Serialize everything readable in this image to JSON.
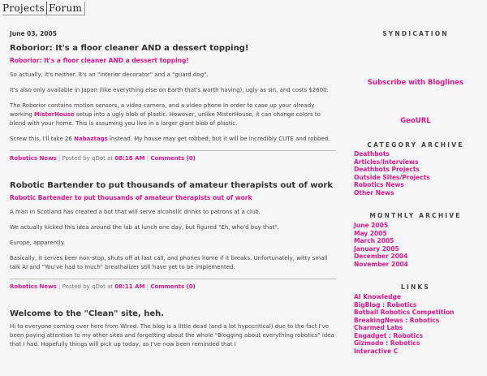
{
  "header": {
    "logo_left": "Projects",
    "logo_right": "Forum"
  },
  "posts": [
    {
      "date": "June 03, 2005",
      "title": "Roborior: It's a floor cleaner AND a dessert topping!",
      "link": "Roborior: It's a floor cleaner AND a dessert topping!",
      "p1": "So actually, it's neither. It's an \"interior decorator\" and a \"guard dog\".",
      "p2": "It's also only available in Japan (like everything else on Earth that's worth having), ugly as sin, and costs $2600.",
      "p3a": "The Roborior contains motion sensors, a video camera, and a video phone in order to case up your already working ",
      "p3link": "MisterHouse",
      "p3b": " setup into a ugly blob of plastic. However, unlike MisterHouse, it can change colors to blend with your home. This is assuming you live in a larger giant blob of plastic.",
      "p4a": "Screw this, I'll take 26 ",
      "p4link": "Nabaztags",
      "p4b": " instead. My house may get robbed, but it will be incredibly CUTE and robbed.",
      "category": "Robotics News",
      "posted": "Posted by qDot at",
      "time": "08:18 AM",
      "comments": "Comments (0)"
    },
    {
      "title": "Robotic Bartender to put thousands of amateur therapists out of work",
      "link": "Robotic Bartender to put thousands of amateur therapists out of work",
      "p1": "A man in Scotland has created a bot that will serve alcoholic drinks to patrons at a club.",
      "p2": "We actually kicked this idea around the lab at lunch one day, but figured \"Eh, who'd buy that\".",
      "p3": "Europe, apparently.",
      "p4": "Basically, it serves beer non-stop, shuts off at last call, and phones home if it breaks. Unfortunately, witty small talk AI and \"You've had to much\" breathalizer still have yet to be implemented.",
      "category": "Robotics News",
      "posted": "Posted by qDot at",
      "time": "08:11 AM",
      "comments": "Comments (0)"
    },
    {
      "title": "Welcome to the \"Clean\" site, heh.",
      "p1": "Hi to everyone coming over here from Wired. The blog is a little dead (and a lot hypocritical) due to the fact I've been paying attention to my other sites and forgetting about the whole \"Blogging about everything robotics\" idea that I had. Hopefully things will pick up today, as I've now been reminded that I"
    }
  ],
  "sidebar": {
    "syndication": "SYNDICATION",
    "bloglines": "Subscribe with Bloglines",
    "geourl": "GeoURL",
    "category_title": "CATEGORY ARCHIVE",
    "categories": [
      "Deathbots",
      "Articles/Interviews",
      "Deathbots Projects",
      "Outside Sites/Projects",
      "Robotics News",
      "Other News"
    ],
    "monthly_title": "MONTHLY ARCHIVE",
    "months": [
      "June 2005",
      "May 2005",
      "March 2005",
      "January 2005",
      "December 2004",
      "November 2004"
    ],
    "links_title": "LINKS",
    "links": [
      "AI Knowledge",
      "BigBlog : Robotics",
      "Botball Robotics Competition",
      "BreakingNews : Robotics",
      "Charmed Labs",
      "Engadget : Robotics",
      "Gizmodo : Robotics",
      "Interactive C"
    ]
  },
  "colors": {
    "accent": "#e0198a",
    "background": "#f6f6f6"
  }
}
